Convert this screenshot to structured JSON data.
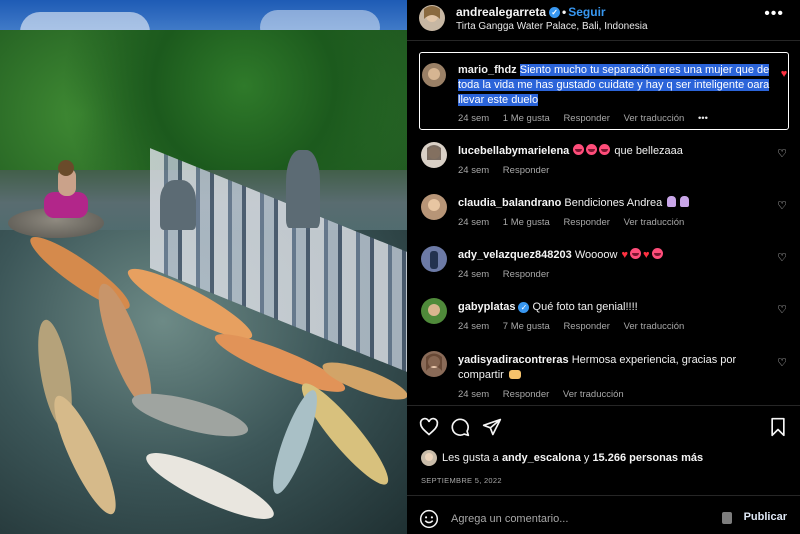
{
  "post": {
    "author": "andrealegarreta",
    "follow_label": "Seguir",
    "location": "Tirta Gangga Water Palace, Bali, Indonesia",
    "more_label": "•••"
  },
  "highlighted_comment": {
    "user": "mario_fhdz",
    "text": "Siento mucho tu separación eres una mujer que de toda la vida me has gustado cuidate y hay q ser inteligente oara llevar este duelo",
    "time": "24 sem",
    "likes": "1 Me gusta",
    "reply": "Responder",
    "translate": "Ver traducción",
    "more": "•••"
  },
  "comments": [
    {
      "user": "lucebellabymarielena",
      "text": "que bellezaaa",
      "time": "24 sem",
      "reply": "Responder"
    },
    {
      "user": "claudia_balandrano",
      "text": "Bendiciones Andrea",
      "time": "24 sem",
      "likes": "1 Me gusta",
      "reply": "Responder",
      "translate": "Ver traducción"
    },
    {
      "user": "ady_velazquez848203",
      "text": "Woooow",
      "time": "24 sem",
      "reply": "Responder"
    },
    {
      "user": "gabyplatas",
      "text": "Qué foto tan genial!!!!",
      "time": "24 sem",
      "likes": "7 Me gusta",
      "reply": "Responder",
      "translate": "Ver traducción"
    },
    {
      "user": "yadisyadiracontreras",
      "text": "Hermosa experiencia, gracias por compartir",
      "time": "24 sem",
      "reply": "Responder",
      "translate": "Ver traducción"
    }
  ],
  "likes": {
    "prefix": "Les gusta a",
    "user": "andy_escalona",
    "connector": "y",
    "count": "15.266 personas más"
  },
  "date": "SEPTIEMBRE 5, 2022",
  "add_comment": {
    "placeholder": "Agrega un comentario...",
    "publish_label": "Publicar"
  },
  "icons": {
    "like": "heart-icon",
    "comment": "comment-icon",
    "share": "share-icon",
    "save": "bookmark-icon",
    "emoji": "emoji-icon"
  },
  "colors": {
    "accent": "#3897f0",
    "highlight": "#2b64d9",
    "heart": "#ff3040"
  }
}
